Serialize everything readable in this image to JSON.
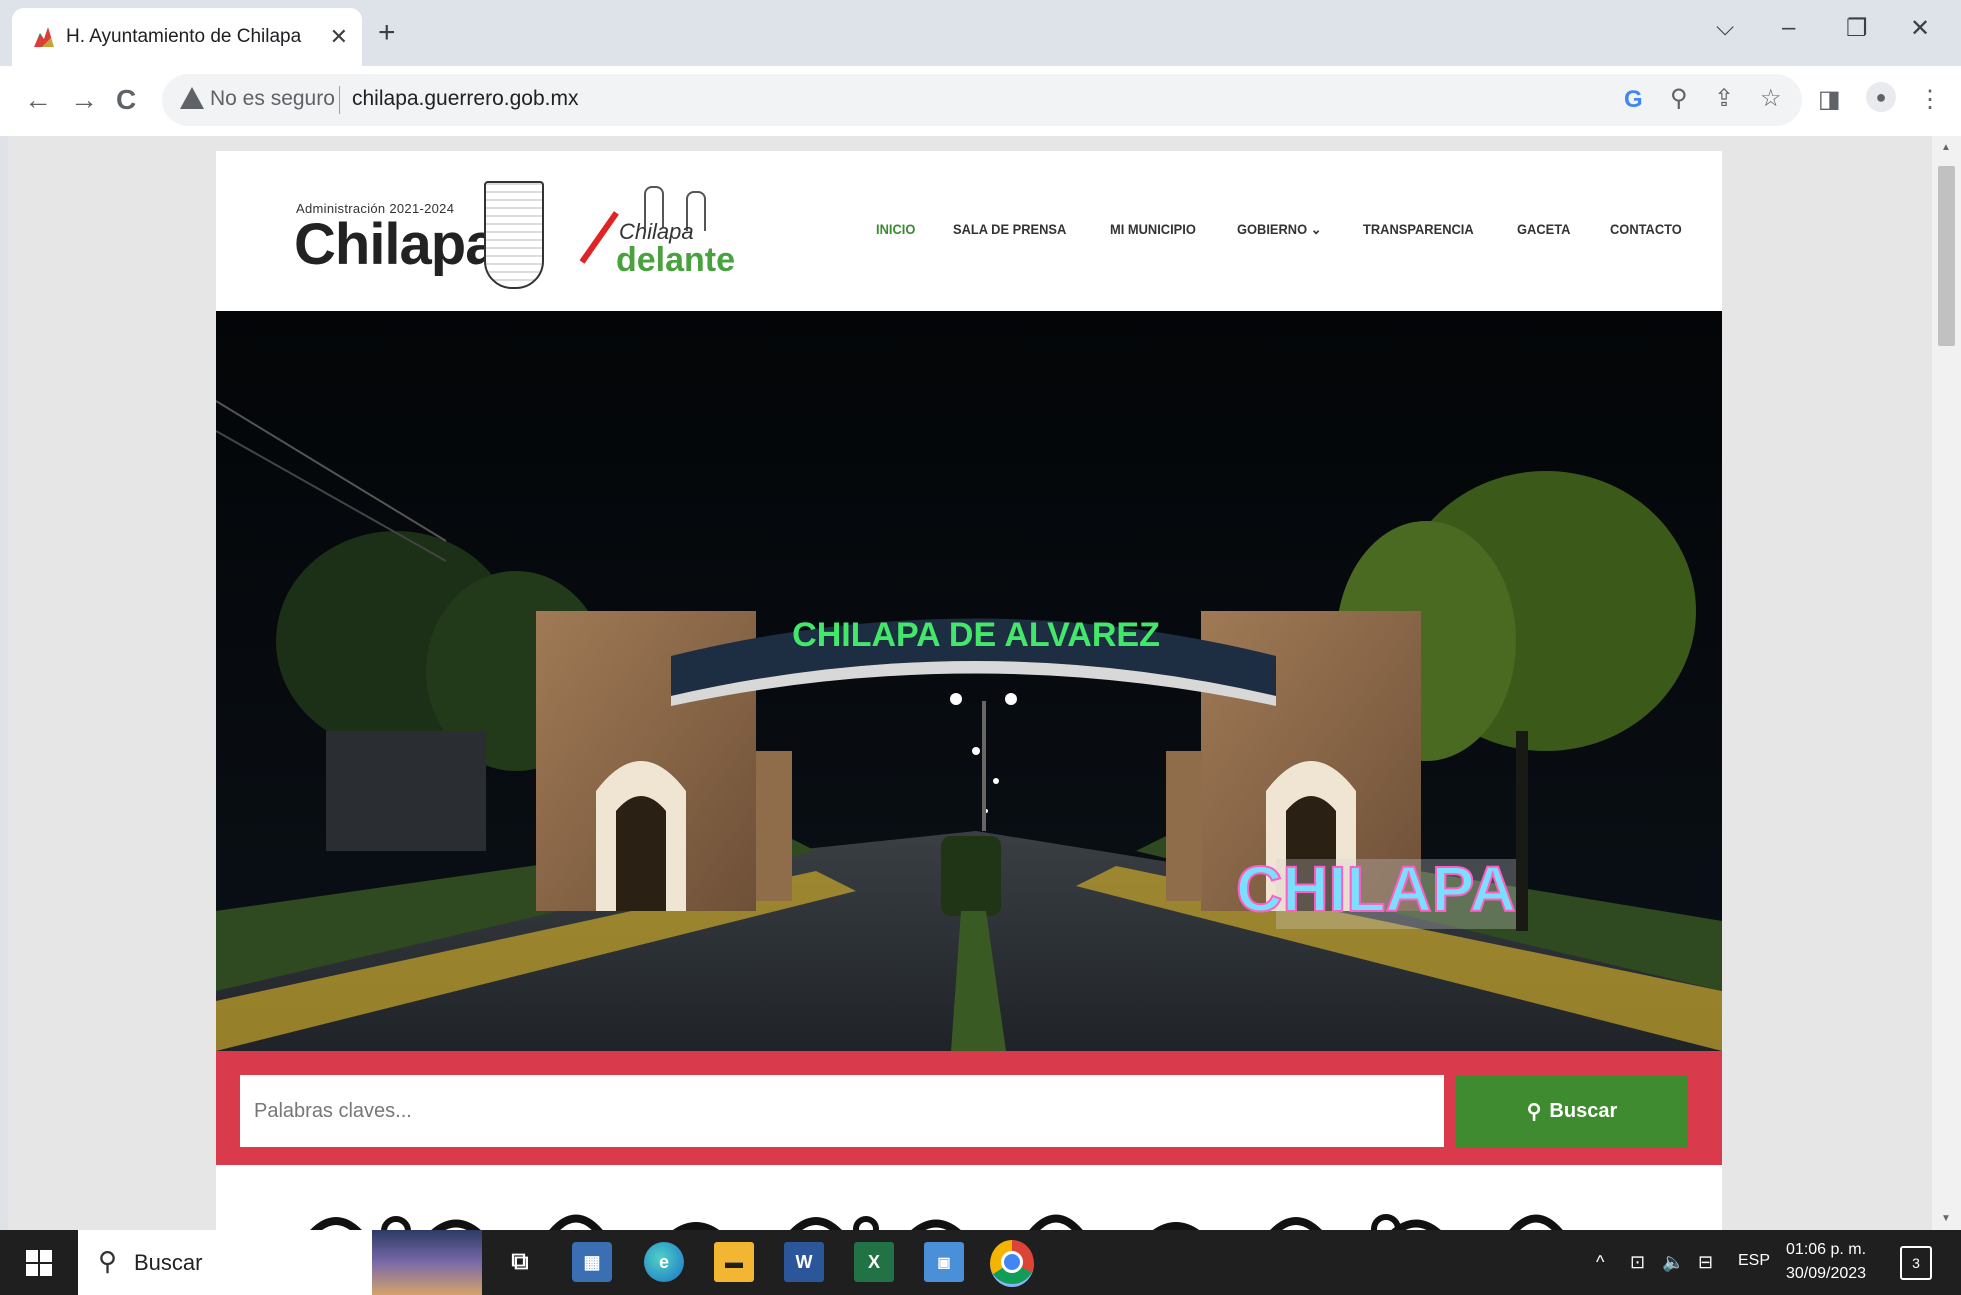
{
  "browser": {
    "tab_title": "H. Ayuntamiento de Chilapa de",
    "tab_close": "✕",
    "new_tab": "+",
    "security_label": "No es seguro",
    "url": "chilapa.guerrero.gob.mx",
    "window_controls": {
      "tabsearch": "⌵",
      "minimize": "–",
      "restore": "❐",
      "close": "✕"
    },
    "nav": {
      "back": "←",
      "forward": "→",
      "reload": "C"
    },
    "toolbar_icons": {
      "google": "G",
      "zoom": "⚲",
      "share": "⇪",
      "bookmark": "☆",
      "sidepanel": "◨",
      "profile": "●",
      "menu": "⋮"
    }
  },
  "site": {
    "logo": {
      "admin_line": "Administración 2021-2024",
      "name": "Chilapa",
      "slogan_script": "Chilapa",
      "slogan": "delante"
    },
    "nav": [
      {
        "label": "INICIO",
        "active": true
      },
      {
        "label": "SALA DE PRENSA",
        "active": false
      },
      {
        "label": "MI MUNICIPIO",
        "active": false
      },
      {
        "label": "GOBIERNO ⌄",
        "active": false
      },
      {
        "label": "TRANSPARENCIA",
        "active": false
      },
      {
        "label": "GACETA",
        "active": false
      },
      {
        "label": "CONTACTO",
        "active": false
      }
    ],
    "hero": {
      "arch_sign": "CHILAPA DE ALVAREZ",
      "letters_sign": "CHILAPA"
    },
    "search": {
      "placeholder": "Palabras claves...",
      "button_label": "Buscar"
    },
    "scroll_top": "↑"
  },
  "taskbar": {
    "search_label": "Buscar",
    "tray": {
      "caret": "^",
      "language": "ESP"
    },
    "time": "01:06 p. m.",
    "date": "30/09/2023",
    "notifications": "3"
  },
  "colors": {
    "accent_green": "#3f8b30",
    "search_band": "#d93a4c",
    "nav_active": "#3a8a2f"
  }
}
